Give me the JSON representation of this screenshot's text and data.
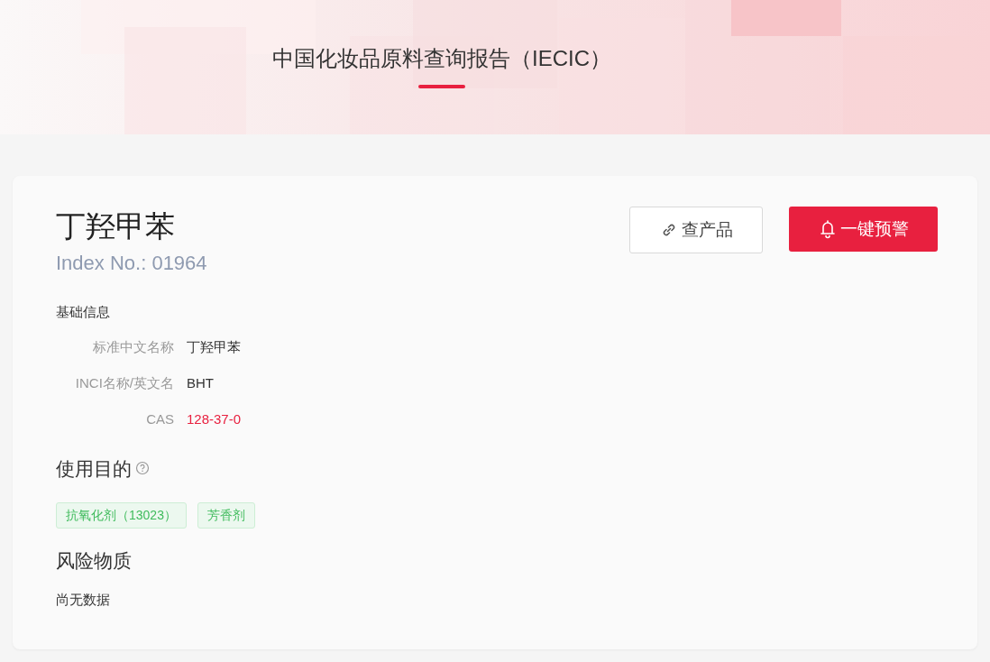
{
  "header": {
    "title": "中国化妆品原料查询报告（IECIC）"
  },
  "ingredient": {
    "name": "丁羟甲苯",
    "index_no": "Index No.: 01964"
  },
  "actions": [
    {
      "kind": "outline",
      "label": "查产品"
    },
    {
      "kind": "primary",
      "label": "一键预警"
    }
  ],
  "basic_info": {
    "heading": "基础信息",
    "fields": [
      {
        "kind": "plain",
        "label": "标准中文名称",
        "value": "丁羟甲苯"
      },
      {
        "kind": "plain",
        "label": "INCI名称/英文名",
        "value": "BHT"
      },
      {
        "kind": "link",
        "label": "CAS",
        "value": "128-37-0"
      }
    ]
  },
  "purpose": {
    "heading": "使用目的",
    "tags": [
      "抗氧化剂（13023）",
      "芳香剂"
    ]
  },
  "risk": {
    "heading": "风险物质",
    "empty_text": "尚无数据"
  }
}
